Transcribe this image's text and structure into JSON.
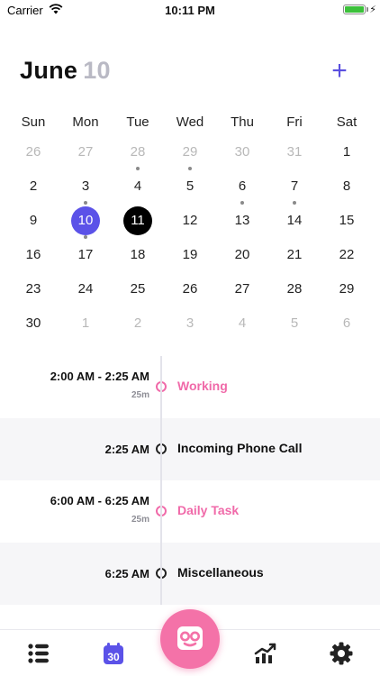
{
  "status_bar": {
    "carrier": "Carrier",
    "time": "10:11 PM"
  },
  "header": {
    "month": "June",
    "day": "10",
    "add_label": "+"
  },
  "calendar": {
    "weekdays": [
      "Sun",
      "Mon",
      "Tue",
      "Wed",
      "Thu",
      "Fri",
      "Sat"
    ],
    "weeks": [
      [
        {
          "d": "26",
          "muted": true
        },
        {
          "d": "27",
          "muted": true
        },
        {
          "d": "28",
          "muted": true,
          "dot": true
        },
        {
          "d": "29",
          "muted": true,
          "dot": true
        },
        {
          "d": "30",
          "muted": true
        },
        {
          "d": "31",
          "muted": true
        },
        {
          "d": "1"
        }
      ],
      [
        {
          "d": "2"
        },
        {
          "d": "3",
          "dot": true
        },
        {
          "d": "4"
        },
        {
          "d": "5"
        },
        {
          "d": "6",
          "dot": true
        },
        {
          "d": "7",
          "dot": true
        },
        {
          "d": "8"
        }
      ],
      [
        {
          "d": "9"
        },
        {
          "d": "10",
          "selected": true,
          "dot": true
        },
        {
          "d": "11",
          "today": true
        },
        {
          "d": "12"
        },
        {
          "d": "13"
        },
        {
          "d": "14"
        },
        {
          "d": "15"
        }
      ],
      [
        {
          "d": "16"
        },
        {
          "d": "17"
        },
        {
          "d": "18"
        },
        {
          "d": "19"
        },
        {
          "d": "20"
        },
        {
          "d": "21"
        },
        {
          "d": "22"
        }
      ],
      [
        {
          "d": "23"
        },
        {
          "d": "24"
        },
        {
          "d": "25"
        },
        {
          "d": "26"
        },
        {
          "d": "27"
        },
        {
          "d": "28"
        },
        {
          "d": "29"
        }
      ],
      [
        {
          "d": "30"
        },
        {
          "d": "1",
          "muted": true
        },
        {
          "d": "2",
          "muted": true
        },
        {
          "d": "3",
          "muted": true
        },
        {
          "d": "4",
          "muted": true
        },
        {
          "d": "5",
          "muted": true
        },
        {
          "d": "6",
          "muted": true
        }
      ]
    ]
  },
  "timeline": [
    {
      "time": "2:00 AM - 2:25 AM",
      "duration": "25m",
      "title": "Working",
      "accent": "#f06aa9"
    },
    {
      "time": "2:25 AM",
      "duration": "",
      "title": "Incoming Phone Call",
      "accent": "#222222"
    },
    {
      "time": "6:00 AM - 6:25 AM",
      "duration": "25m",
      "title": "Daily Task",
      "accent": "#f06aa9"
    },
    {
      "time": "6:25 AM",
      "duration": "",
      "title": "Miscellaneous",
      "accent": "#222222"
    }
  ],
  "tab_bar": {
    "tabs": [
      {
        "icon": "list-icon",
        "active": false
      },
      {
        "icon": "calendar-icon",
        "badge": "30",
        "active": true
      },
      {
        "icon": "robot-face-icon",
        "active": false
      },
      {
        "icon": "chart-icon",
        "active": false
      },
      {
        "icon": "gear-icon",
        "active": false
      }
    ],
    "accent": "#5b52e8"
  }
}
